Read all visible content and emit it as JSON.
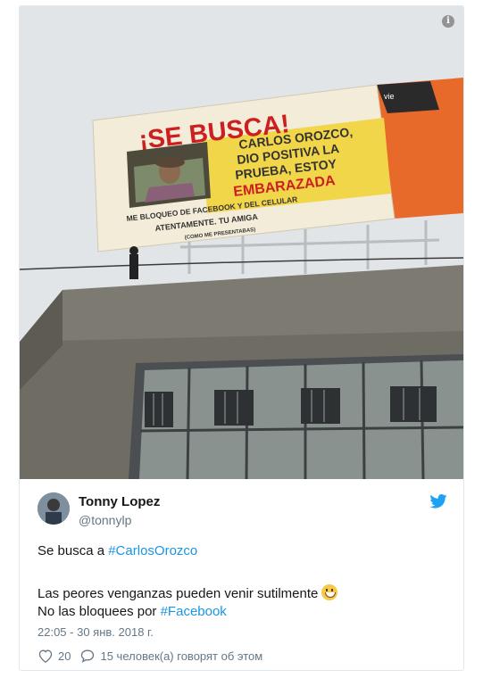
{
  "photo": {
    "billboard": {
      "headline": "¡SE BUSCA!",
      "lines": [
        "CARLOS OROZCO,",
        "DIO POSITIVA LA",
        "PRUEBA, ESTOY"
      ],
      "emphasis": "EMBARAZADA",
      "footer1": "ME BLOQUEO DE FACEBOOK Y DEL CELULAR",
      "footer2": "ATENTAMENTE. TU AMIGA",
      "footer3": "(COMO ME PRESENTABAS)",
      "side_text": "vie"
    },
    "info_icon": "info-icon"
  },
  "tweet": {
    "author_name": "Tonny Lopez",
    "author_handle": "@tonnylp",
    "line1_prefix": "Se busca a ",
    "line1_hashtag": "#CarlosOrozco",
    "line2": "Las peores venganzas pueden venir sutilmente",
    "line3_prefix": "No las bloquees por ",
    "line3_hashtag": "#Facebook",
    "timestamp": "22:05 - 30 янв. 2018 г.",
    "likes": "20",
    "replies_text": "15 человек(а) говорят об этом",
    "colors": {
      "link": "#1b95e0",
      "muted": "#657786",
      "text": "#14171a"
    }
  }
}
